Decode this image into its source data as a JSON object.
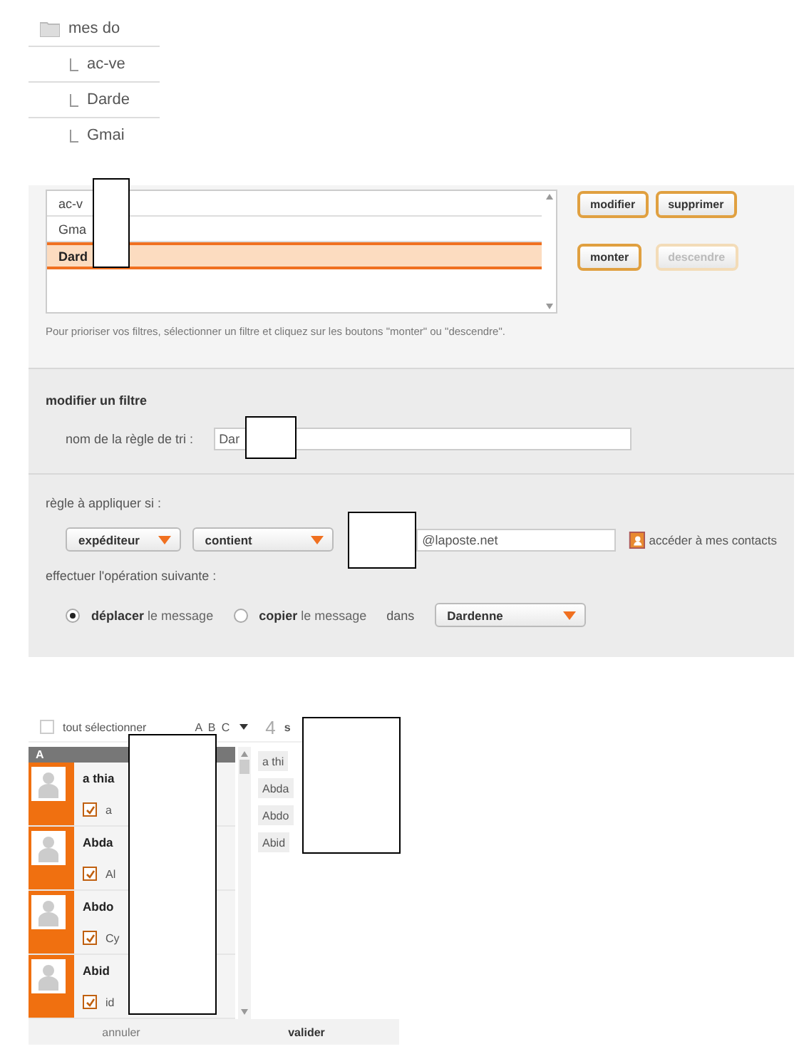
{
  "folders": {
    "title": "mes do",
    "items": [
      "ac-ve",
      "Darde",
      "Gmai"
    ]
  },
  "filters": {
    "rows": [
      {
        "label": "ac-v",
        "selected": false
      },
      {
        "label": "Gma",
        "selected": false
      },
      {
        "label": "Dard",
        "selected": true
      }
    ],
    "buttons": [
      {
        "label": "modifier",
        "disabled": false
      },
      {
        "label": "supprimer",
        "disabled": false
      },
      {
        "label": "monter",
        "disabled": false
      },
      {
        "label": "descendre",
        "disabled": true
      }
    ],
    "hint": "Pour prioriser vos filtres, sélectionner un filtre et cliquez sur les boutons \"monter\" ou \"descendre\"."
  },
  "edit": {
    "title": "modifier un filtre",
    "name_label": "nom de la règle de tri :",
    "name_value": "Dar",
    "rule_label": "règle à appliquer si :",
    "field_select": "expéditeur",
    "op_select": "contient",
    "address_value": "@laposte.net",
    "contacts_link": "accéder à mes contacts",
    "action_label": "effectuer l'opération suivante :",
    "actions": [
      {
        "bold": "déplacer",
        "rest": "le message",
        "selected": true
      },
      {
        "bold": "copier",
        "rest": "le message",
        "selected": false
      }
    ],
    "in_label": "dans",
    "folder_select": "Dardenne"
  },
  "picker": {
    "select_all": "tout sélectionner",
    "select_all_checked": false,
    "sort": "A B C",
    "count": "4",
    "count_text": "s",
    "section": "A",
    "contacts": [
      {
        "name": "a thia",
        "detail": "a",
        "checked": true
      },
      {
        "name": "Abda",
        "detail": "Al",
        "checked": true
      },
      {
        "name": "Abdo",
        "detail": "Cy",
        "checked": true
      },
      {
        "name": "Abid",
        "detail": "id",
        "checked": true
      }
    ],
    "chosen": [
      "a thi",
      "Abda",
      "Abdo",
      "Abid"
    ],
    "cancel": "annuler",
    "confirm": "valider"
  }
}
